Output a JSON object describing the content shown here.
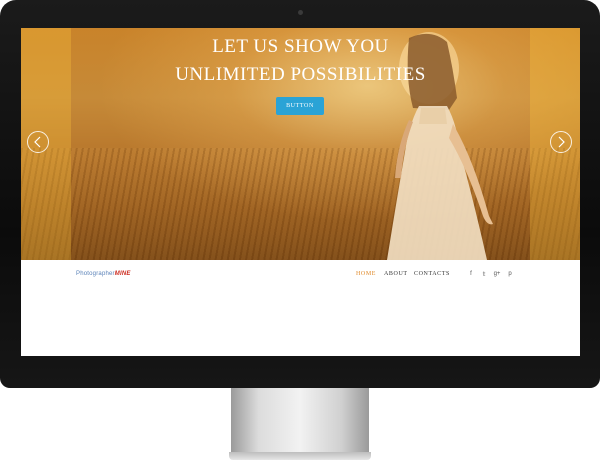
{
  "hero": {
    "line1": "LET US SHOW YOU",
    "line2": "UNLIMITED POSSIBILITIES",
    "button_label": "BUTTON",
    "prev_icon": "chevron-left-icon",
    "next_icon": "chevron-right-icon"
  },
  "navbar": {
    "logo_part1": "Photographer",
    "logo_part2": "MINE",
    "links": [
      {
        "label": "HOME",
        "active": true
      },
      {
        "label": "ABOUT",
        "active": false
      },
      {
        "label": "CONTACTS",
        "active": false
      }
    ],
    "social": [
      {
        "icon": "facebook-icon",
        "glyph": "f"
      },
      {
        "icon": "twitter-icon",
        "glyph": "𝕥"
      },
      {
        "icon": "google-plus-icon",
        "glyph": "g+"
      },
      {
        "icon": "pinterest-icon",
        "glyph": "p"
      }
    ]
  },
  "colors": {
    "accent": "#2aa3d6",
    "nav_active": "#e08a2b",
    "logo_blue": "#5a82b8",
    "logo_red": "#cc2a1e"
  }
}
